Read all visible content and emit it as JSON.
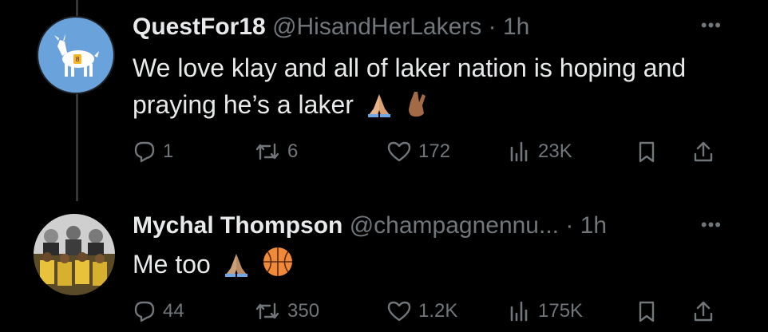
{
  "tweets": [
    {
      "display_name": "QuestFor18",
      "handle": "@HisandHerLakers",
      "separator": "·",
      "time": "1h",
      "text": "We love klay and all of laker nation is hoping and praying he’s a laker",
      "emojis": [
        "folded-hands",
        "crossed-fingers"
      ],
      "stats": {
        "replies": "1",
        "reposts": "6",
        "likes": "172",
        "views": "23K"
      },
      "more_icon": "more-horizontal-icon"
    },
    {
      "display_name": "Mychal Thompson",
      "handle": "@champagnennu...",
      "separator": "·",
      "time": "1h",
      "text": "Me too",
      "emojis": [
        "folded-hands",
        "basketball"
      ],
      "stats": {
        "replies": "44",
        "reposts": "350",
        "likes": "1.2K",
        "views": "175K"
      },
      "more_icon": "more-horizontal-icon"
    }
  ],
  "colors": {
    "background": "#000000",
    "text": "#e7e9ea",
    "muted": "#71767b",
    "thread_line": "#333639",
    "avatar_1_bg": "#6aa2dc"
  }
}
